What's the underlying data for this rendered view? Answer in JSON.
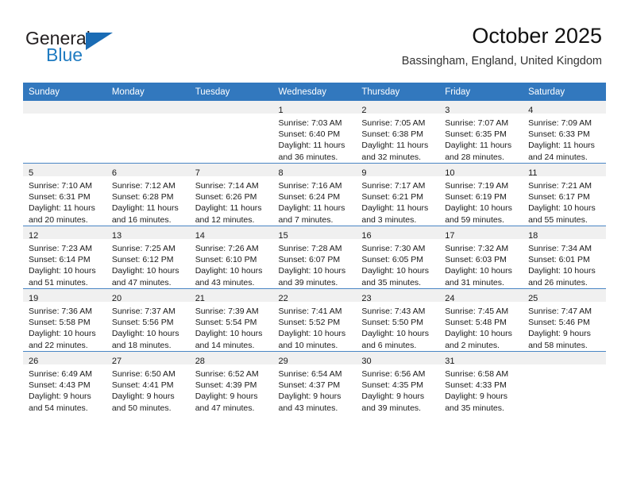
{
  "brand": {
    "name_part1": "General",
    "name_part2": "Blue"
  },
  "header": {
    "title": "October 2025",
    "subtitle": "Bassingham, England, United Kingdom"
  },
  "colors": {
    "header_blue": "#3278be",
    "row_border_blue": "#4a86c5",
    "daynum_strip": "#f0f0f0",
    "brand_blue": "#1f7bc1"
  },
  "weekday_headers": [
    "Sunday",
    "Monday",
    "Tuesday",
    "Wednesday",
    "Thursday",
    "Friday",
    "Saturday"
  ],
  "weeks": [
    [
      {
        "day": "",
        "lines": []
      },
      {
        "day": "",
        "lines": []
      },
      {
        "day": "",
        "lines": []
      },
      {
        "day": "1",
        "lines": [
          "Sunrise: 7:03 AM",
          "Sunset: 6:40 PM",
          "Daylight: 11 hours",
          "and 36 minutes."
        ]
      },
      {
        "day": "2",
        "lines": [
          "Sunrise: 7:05 AM",
          "Sunset: 6:38 PM",
          "Daylight: 11 hours",
          "and 32 minutes."
        ]
      },
      {
        "day": "3",
        "lines": [
          "Sunrise: 7:07 AM",
          "Sunset: 6:35 PM",
          "Daylight: 11 hours",
          "and 28 minutes."
        ]
      },
      {
        "day": "4",
        "lines": [
          "Sunrise: 7:09 AM",
          "Sunset: 6:33 PM",
          "Daylight: 11 hours",
          "and 24 minutes."
        ]
      }
    ],
    [
      {
        "day": "5",
        "lines": [
          "Sunrise: 7:10 AM",
          "Sunset: 6:31 PM",
          "Daylight: 11 hours",
          "and 20 minutes."
        ]
      },
      {
        "day": "6",
        "lines": [
          "Sunrise: 7:12 AM",
          "Sunset: 6:28 PM",
          "Daylight: 11 hours",
          "and 16 minutes."
        ]
      },
      {
        "day": "7",
        "lines": [
          "Sunrise: 7:14 AM",
          "Sunset: 6:26 PM",
          "Daylight: 11 hours",
          "and 12 minutes."
        ]
      },
      {
        "day": "8",
        "lines": [
          "Sunrise: 7:16 AM",
          "Sunset: 6:24 PM",
          "Daylight: 11 hours",
          "and 7 minutes."
        ]
      },
      {
        "day": "9",
        "lines": [
          "Sunrise: 7:17 AM",
          "Sunset: 6:21 PM",
          "Daylight: 11 hours",
          "and 3 minutes."
        ]
      },
      {
        "day": "10",
        "lines": [
          "Sunrise: 7:19 AM",
          "Sunset: 6:19 PM",
          "Daylight: 10 hours",
          "and 59 minutes."
        ]
      },
      {
        "day": "11",
        "lines": [
          "Sunrise: 7:21 AM",
          "Sunset: 6:17 PM",
          "Daylight: 10 hours",
          "and 55 minutes."
        ]
      }
    ],
    [
      {
        "day": "12",
        "lines": [
          "Sunrise: 7:23 AM",
          "Sunset: 6:14 PM",
          "Daylight: 10 hours",
          "and 51 minutes."
        ]
      },
      {
        "day": "13",
        "lines": [
          "Sunrise: 7:25 AM",
          "Sunset: 6:12 PM",
          "Daylight: 10 hours",
          "and 47 minutes."
        ]
      },
      {
        "day": "14",
        "lines": [
          "Sunrise: 7:26 AM",
          "Sunset: 6:10 PM",
          "Daylight: 10 hours",
          "and 43 minutes."
        ]
      },
      {
        "day": "15",
        "lines": [
          "Sunrise: 7:28 AM",
          "Sunset: 6:07 PM",
          "Daylight: 10 hours",
          "and 39 minutes."
        ]
      },
      {
        "day": "16",
        "lines": [
          "Sunrise: 7:30 AM",
          "Sunset: 6:05 PM",
          "Daylight: 10 hours",
          "and 35 minutes."
        ]
      },
      {
        "day": "17",
        "lines": [
          "Sunrise: 7:32 AM",
          "Sunset: 6:03 PM",
          "Daylight: 10 hours",
          "and 31 minutes."
        ]
      },
      {
        "day": "18",
        "lines": [
          "Sunrise: 7:34 AM",
          "Sunset: 6:01 PM",
          "Daylight: 10 hours",
          "and 26 minutes."
        ]
      }
    ],
    [
      {
        "day": "19",
        "lines": [
          "Sunrise: 7:36 AM",
          "Sunset: 5:58 PM",
          "Daylight: 10 hours",
          "and 22 minutes."
        ]
      },
      {
        "day": "20",
        "lines": [
          "Sunrise: 7:37 AM",
          "Sunset: 5:56 PM",
          "Daylight: 10 hours",
          "and 18 minutes."
        ]
      },
      {
        "day": "21",
        "lines": [
          "Sunrise: 7:39 AM",
          "Sunset: 5:54 PM",
          "Daylight: 10 hours",
          "and 14 minutes."
        ]
      },
      {
        "day": "22",
        "lines": [
          "Sunrise: 7:41 AM",
          "Sunset: 5:52 PM",
          "Daylight: 10 hours",
          "and 10 minutes."
        ]
      },
      {
        "day": "23",
        "lines": [
          "Sunrise: 7:43 AM",
          "Sunset: 5:50 PM",
          "Daylight: 10 hours",
          "and 6 minutes."
        ]
      },
      {
        "day": "24",
        "lines": [
          "Sunrise: 7:45 AM",
          "Sunset: 5:48 PM",
          "Daylight: 10 hours",
          "and 2 minutes."
        ]
      },
      {
        "day": "25",
        "lines": [
          "Sunrise: 7:47 AM",
          "Sunset: 5:46 PM",
          "Daylight: 9 hours",
          "and 58 minutes."
        ]
      }
    ],
    [
      {
        "day": "26",
        "lines": [
          "Sunrise: 6:49 AM",
          "Sunset: 4:43 PM",
          "Daylight: 9 hours",
          "and 54 minutes."
        ]
      },
      {
        "day": "27",
        "lines": [
          "Sunrise: 6:50 AM",
          "Sunset: 4:41 PM",
          "Daylight: 9 hours",
          "and 50 minutes."
        ]
      },
      {
        "day": "28",
        "lines": [
          "Sunrise: 6:52 AM",
          "Sunset: 4:39 PM",
          "Daylight: 9 hours",
          "and 47 minutes."
        ]
      },
      {
        "day": "29",
        "lines": [
          "Sunrise: 6:54 AM",
          "Sunset: 4:37 PM",
          "Daylight: 9 hours",
          "and 43 minutes."
        ]
      },
      {
        "day": "30",
        "lines": [
          "Sunrise: 6:56 AM",
          "Sunset: 4:35 PM",
          "Daylight: 9 hours",
          "and 39 minutes."
        ]
      },
      {
        "day": "31",
        "lines": [
          "Sunrise: 6:58 AM",
          "Sunset: 4:33 PM",
          "Daylight: 9 hours",
          "and 35 minutes."
        ]
      },
      {
        "day": "",
        "lines": []
      }
    ]
  ]
}
